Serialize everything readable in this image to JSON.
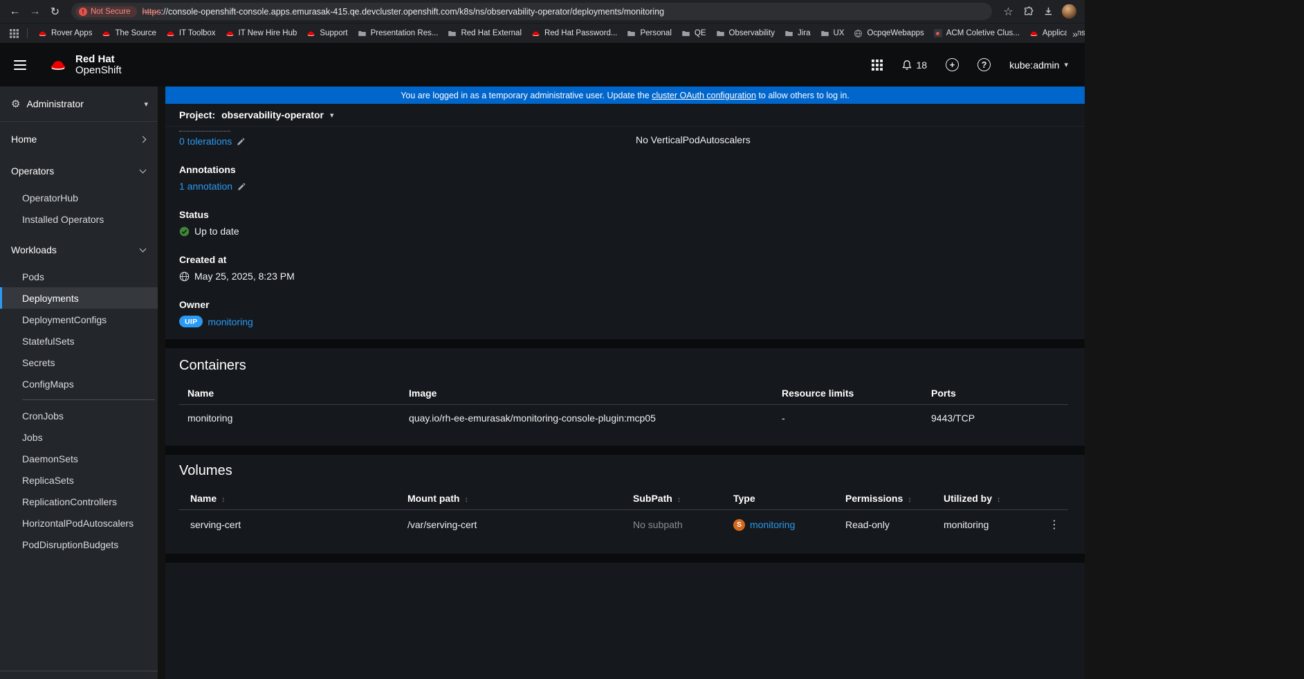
{
  "colors": {
    "banner_bg": "#0066cc",
    "link": "#2b9af3",
    "success_green": "#3e8635",
    "owner_badge_bg": "#2b9af3",
    "secret_badge_bg": "#d4681c",
    "nav_active_border": "#2b9af3"
  },
  "icons": {
    "back": "←",
    "forward": "→",
    "reload": "↻",
    "star": "☆",
    "gear": "⚙",
    "caret": "▾",
    "plus": "+",
    "question": "?",
    "kebab": "⋮",
    "sort": "↕"
  },
  "browser": {
    "security_label": "Not Secure",
    "url_scheme": "https",
    "url_rest": "://console-openshift-console.apps.emurasak-415.qe.devcluster.openshift.com/k8s/ns/observability-operator/deployments/monitoring",
    "overflow": "»",
    "bookmarks": [
      {
        "label": "Rover Apps",
        "icon": "redhat"
      },
      {
        "label": "The Source",
        "icon": "redhat"
      },
      {
        "label": "IT Toolbox",
        "icon": "redhat"
      },
      {
        "label": "IT New Hire Hub",
        "icon": "redhat"
      },
      {
        "label": "Support",
        "icon": "redhat"
      },
      {
        "label": "Presentation Res...",
        "icon": "folder"
      },
      {
        "label": "Red Hat External",
        "icon": "folder"
      },
      {
        "label": "Red Hat Password...",
        "icon": "redhat"
      },
      {
        "label": "Personal",
        "icon": "folder"
      },
      {
        "label": "QE",
        "icon": "folder"
      },
      {
        "label": "Observability",
        "icon": "folder"
      },
      {
        "label": "Jira",
        "icon": "folder"
      },
      {
        "label": "UX",
        "icon": "folder"
      },
      {
        "label": "OcpqeWebapps",
        "icon": "globe"
      },
      {
        "label": "ACM Coletive Clus...",
        "icon": "acm"
      },
      {
        "label": "Applications | Konf...",
        "icon": "redhat"
      }
    ]
  },
  "masthead": {
    "brand_line1": "Red Hat",
    "brand_line2": "OpenShift",
    "notification_count": "18",
    "user": "kube:admin"
  },
  "sidebar": {
    "perspective": "Administrator",
    "items": [
      {
        "label": "Home"
      },
      {
        "label": "Operators"
      },
      {
        "label": "OperatorHub"
      },
      {
        "label": "Installed Operators"
      },
      {
        "label": "Workloads"
      },
      {
        "label": "Pods"
      },
      {
        "label": "Deployments"
      },
      {
        "label": "DeploymentConfigs"
      },
      {
        "label": "StatefulSets"
      },
      {
        "label": "Secrets"
      },
      {
        "label": "ConfigMaps"
      },
      {
        "label": "CronJobs"
      },
      {
        "label": "Jobs"
      },
      {
        "label": "DaemonSets"
      },
      {
        "label": "ReplicaSets"
      },
      {
        "label": "ReplicationControllers"
      },
      {
        "label": "HorizontalPodAutoscalers"
      },
      {
        "label": "PodDisruptionBudgets"
      }
    ]
  },
  "banner": {
    "text_before": "You are logged in as a temporary administrative user. Update the ",
    "link_text": "cluster OAuth configuration",
    "text_after": " to allow others to log in."
  },
  "project_bar": {
    "label": "Project:",
    "value": "observability-operator"
  },
  "details": {
    "tolerations_link": "0 tolerations",
    "vpa_text": "No VerticalPodAutoscalers",
    "annotations_label": "Annotations",
    "annotations_link": "1 annotation",
    "status_label": "Status",
    "status_value": "Up to date",
    "created_label": "Created at",
    "created_value": "May 25, 2025, 8:23 PM",
    "owner_label": "Owner",
    "owner_badge": "UIP",
    "owner_link": "monitoring"
  },
  "containers": {
    "title": "Containers",
    "columns": [
      "Name",
      "Image",
      "Resource limits",
      "Ports"
    ],
    "rows": [
      [
        "monitoring",
        "quay.io/rh-ee-emurasak/monitoring-console-plugin:mcp05",
        "-",
        "9443/TCP"
      ]
    ]
  },
  "volumes": {
    "title": "Volumes",
    "columns": [
      "Name",
      "Mount path",
      "SubPath",
      "Type",
      "Permissions",
      "Utilized by"
    ],
    "row": {
      "name": "serving-cert",
      "mount_path": "/var/serving-cert",
      "subpath": "No subpath",
      "type_badge": "S",
      "type_link": "monitoring",
      "permissions": "Read-only",
      "utilized_by": "monitoring"
    }
  }
}
